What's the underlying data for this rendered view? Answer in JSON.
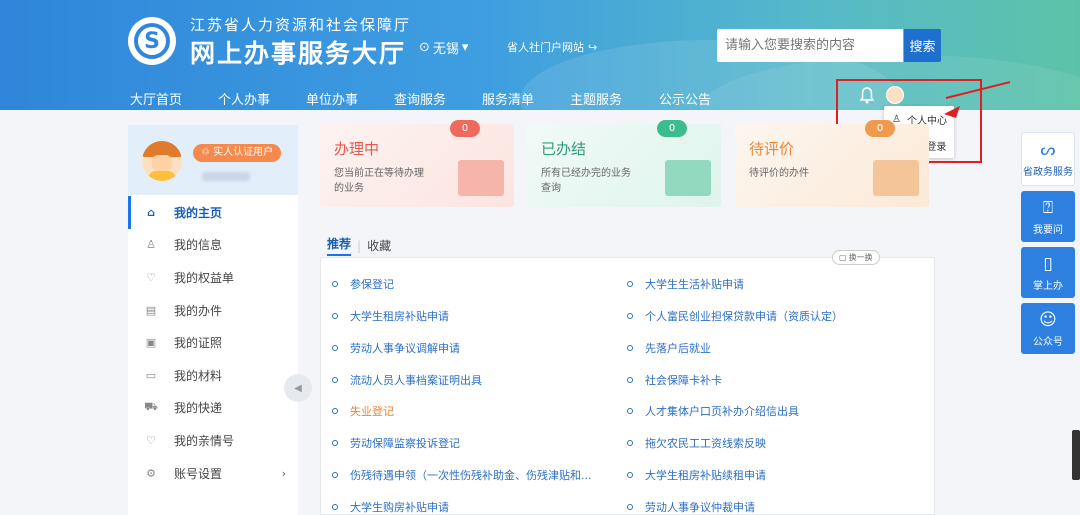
{
  "header": {
    "org_title": "江苏省人力资源和社会保障厅",
    "site_title": "网上办事服务大厅",
    "city": "无锡",
    "portal_link": "省人社门户网站",
    "search_placeholder": "请输入您要搜索的内容",
    "search_button": "搜索"
  },
  "nav": [
    "大厅首页",
    "个人办事",
    "单位办事",
    "查询服务",
    "服务清单",
    "主题服务",
    "公示公告"
  ],
  "user_menu": {
    "personal_center": "个人中心",
    "logout": "退出登录"
  },
  "sidebar": {
    "verify_badge": "实人认证用户",
    "items": [
      {
        "label": "我的主页",
        "icon": "home-icon"
      },
      {
        "label": "我的信息",
        "icon": "user-icon"
      },
      {
        "label": "我的权益单",
        "icon": "shield-icon"
      },
      {
        "label": "我的办件",
        "icon": "document-icon"
      },
      {
        "label": "我的证照",
        "icon": "id-card-icon"
      },
      {
        "label": "我的材料",
        "icon": "folder-icon"
      },
      {
        "label": "我的快递",
        "icon": "truck-icon"
      },
      {
        "label": "我的亲情号",
        "icon": "heart-icon"
      },
      {
        "label": "账号设置",
        "icon": "gear-icon"
      }
    ]
  },
  "cards": [
    {
      "title": "办理中",
      "desc": "您当前正在等待办理的业务",
      "count": "0"
    },
    {
      "title": "已办结",
      "desc": "所有已经办完的业务查询",
      "count": "0"
    },
    {
      "title": "待评价",
      "desc": "待评价的办件",
      "count": "0"
    }
  ],
  "tabs": {
    "recommend": "推荐",
    "favorite": "收藏",
    "swap": "换一换"
  },
  "services_left": [
    "参保登记",
    "大学生租房补贴申请",
    "劳动人事争议调解申请",
    "流动人员人事档案证明出具",
    "失业登记",
    "劳动保障监察投诉登记",
    "伤残待遇申领（一次性伤残补助金、伤残津贴和...",
    "大学生购房补贴申请"
  ],
  "services_right": [
    "大学生生活补贴申请",
    "个人富民创业担保贷款申请（资质认定）",
    "先落户后就业",
    "社会保障卡补卡",
    "人才集体户口页补办介绍信出具",
    "拖欠农民工工资线索反映",
    "大学生租房补贴续租申请",
    "劳动人事争议仲裁申请"
  ],
  "float_buttons": [
    "省政务服务",
    "我要问",
    "掌上办",
    "公众号"
  ],
  "colors": {
    "primary": "#2d7fe0",
    "accent_red": "#e02020",
    "highlight_orange": "#e8873a"
  }
}
